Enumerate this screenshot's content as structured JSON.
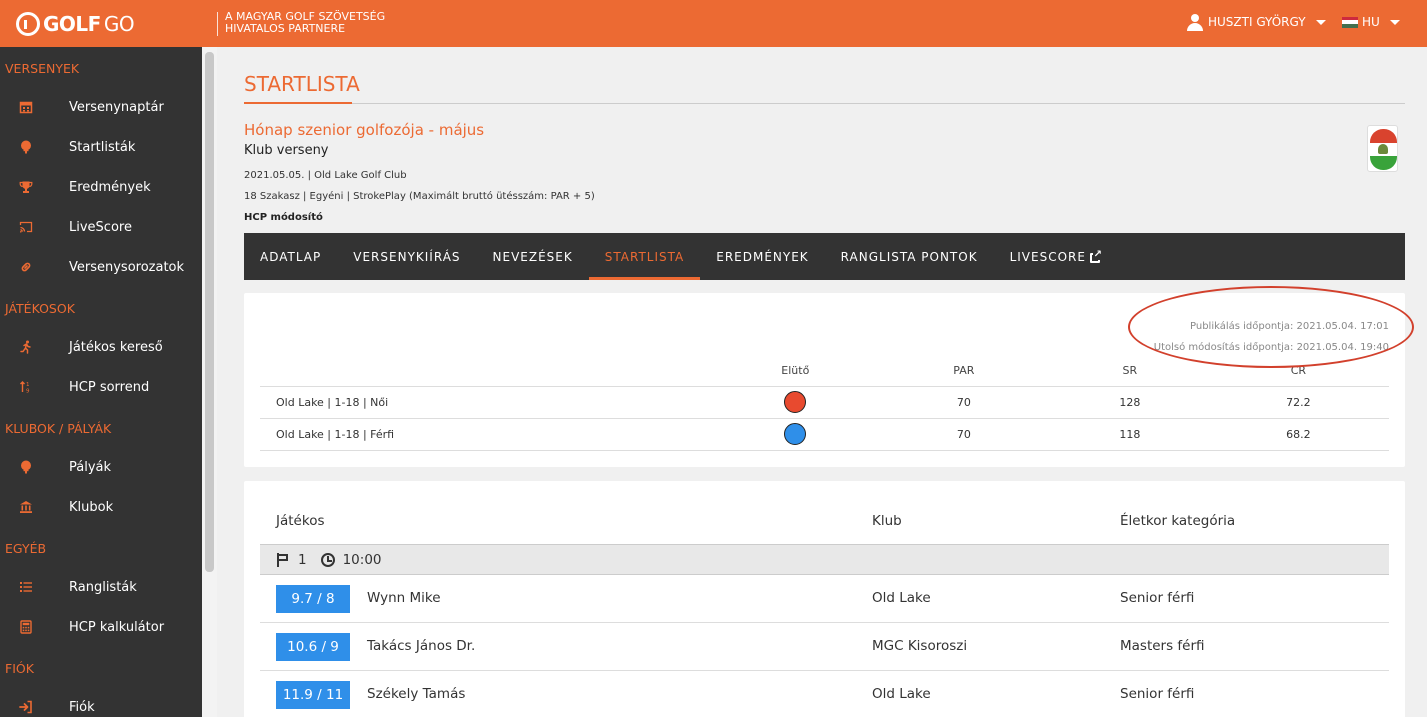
{
  "header": {
    "logo_bold": "GOLF",
    "logo_light": "GO",
    "partner_line1": "A MAGYAR GOLF SZÖVETSÉG",
    "partner_line2": "HIVATALOS PARTNERE",
    "user_name": "HUSZTI GYÖRGY",
    "language": "HU"
  },
  "sidebar": {
    "sections": [
      {
        "label": "VERSENYEK",
        "items": [
          {
            "label": "Versenynaptár",
            "icon": "calendar-icon"
          },
          {
            "label": "Startlisták",
            "icon": "golf-ball-tee-icon"
          },
          {
            "label": "Eredmények",
            "icon": "trophy-icon"
          },
          {
            "label": "LiveScore",
            "icon": "cast-icon"
          },
          {
            "label": "Versenysorozatok",
            "icon": "link-icon"
          }
        ]
      },
      {
        "label": "JÁTÉKOSOK",
        "items": [
          {
            "label": "Játékos kereső",
            "icon": "running-person-icon"
          },
          {
            "label": "HCP sorrend",
            "icon": "sort-icon"
          }
        ]
      },
      {
        "label": "KLUBOK / PÁLYÁK",
        "items": [
          {
            "label": "Pályák",
            "icon": "golf-ball-tee-icon"
          },
          {
            "label": "Klubok",
            "icon": "institution-icon"
          }
        ]
      },
      {
        "label": "EGYÉB",
        "items": [
          {
            "label": "Ranglisták",
            "icon": "list-icon"
          },
          {
            "label": "HCP kalkulátor",
            "icon": "calculator-icon"
          }
        ]
      },
      {
        "label": "FIÓK",
        "items": [
          {
            "label": "Fiók",
            "icon": "sign-in-icon"
          }
        ]
      }
    ]
  },
  "page": {
    "title": "STARTLISTA",
    "competition_name": "Hónap szenior golfozója - május",
    "competition_type": "Klub verseny",
    "meta_line1": "2021.05.05. | Old Lake Golf Club",
    "meta_line2": "18 Szakasz | Egyéni | StrokePlay (Maximált bruttó ütésszám: PAR + 5)",
    "hcp_modifier": "HCP módosító"
  },
  "tabs": [
    {
      "label": "ADATLAP",
      "active": false
    },
    {
      "label": "VERSENYKIÍRÁS",
      "active": false
    },
    {
      "label": "NEVEZÉSEK",
      "active": false
    },
    {
      "label": "STARTLISTA",
      "active": true
    },
    {
      "label": "EREDMÉNYEK",
      "active": false
    },
    {
      "label": "RANGLISTA PONTOK",
      "active": false
    },
    {
      "label": "LIVESCORE",
      "active": false,
      "external": true
    }
  ],
  "publication": {
    "published": "Publikálás időpontja: 2021.05.04. 17:01",
    "modified": "Utolsó módosítás időpontja: 2021.05.04. 19:40"
  },
  "tees": {
    "headers": {
      "tee": "Elütő",
      "par": "PAR",
      "sr": "SR",
      "cr": "CR"
    },
    "rows": [
      {
        "name": "Old Lake | 1-18 | Női",
        "color": "#e84a2f",
        "par": "70",
        "sr": "128",
        "cr": "72.2"
      },
      {
        "name": "Old Lake | 1-18 | Férfi",
        "color": "#2f8fe9",
        "par": "70",
        "sr": "118",
        "cr": "68.2"
      }
    ]
  },
  "startlist": {
    "headers": {
      "player": "Játékos",
      "club": "Klub",
      "category": "Életkor kategória"
    },
    "group": {
      "hole": "1",
      "time": "10:00"
    },
    "players": [
      {
        "hcp": "9.7 / 8",
        "name": "Wynn Mike",
        "club": "Old Lake",
        "category": "Senior férfi"
      },
      {
        "hcp": "10.6 / 9",
        "name": "Takács János Dr.",
        "club": "MGC Kisoroszi",
        "category": "Masters férfi"
      },
      {
        "hcp": "11.9 / 11",
        "name": "Székely Tamás",
        "club": "Old Lake",
        "category": "Senior férfi"
      }
    ]
  },
  "colors": {
    "brand_orange": "#ec6a33",
    "sidebar_bg": "#333333",
    "hcp_badge": "#2f8fe9",
    "annotation_oval": "#d2402c"
  }
}
